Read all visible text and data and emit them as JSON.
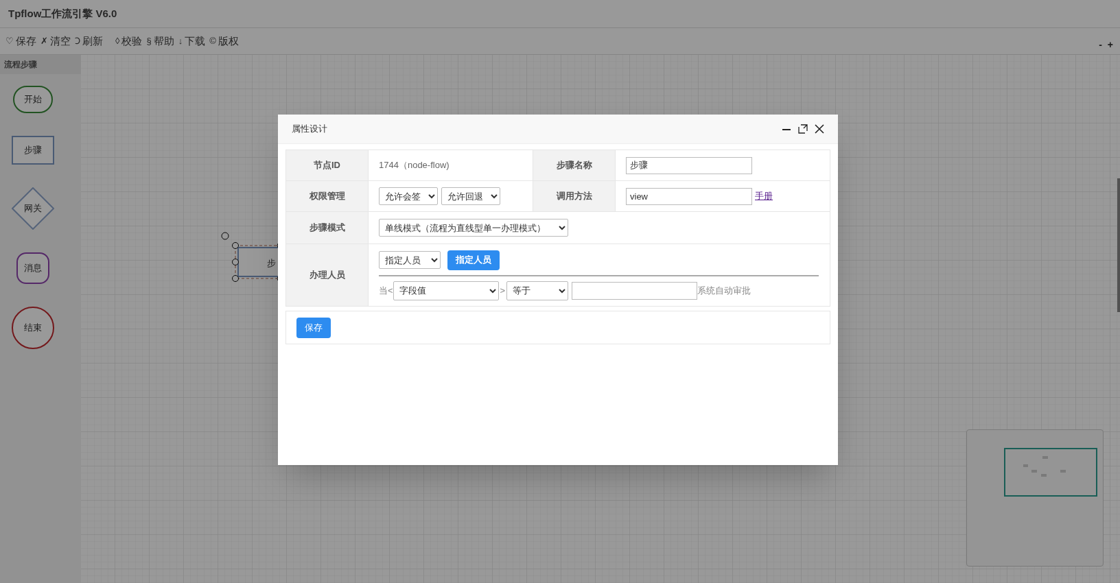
{
  "app": {
    "title": "Tpflow工作流引擎 V6.0"
  },
  "toolbar": [
    {
      "icon": "♡",
      "label": "保存"
    },
    {
      "icon": "✗",
      "label": "清空"
    },
    {
      "icon": "Ↄ",
      "label": "刷新"
    },
    {
      "icon": "◊",
      "label": "校验"
    },
    {
      "icon": "§",
      "label": "帮助"
    },
    {
      "icon": "↓",
      "label": "下载"
    },
    {
      "icon": "©",
      "label": "版权"
    }
  ],
  "zoom_controls": [
    "-",
    "+"
  ],
  "palette": {
    "title": "流程步骤",
    "items": [
      {
        "kind": "start",
        "label": "开始"
      },
      {
        "kind": "step",
        "label": "步骤"
      },
      {
        "kind": "gateway",
        "label": "网关"
      },
      {
        "kind": "message",
        "label": "消息"
      },
      {
        "kind": "end",
        "label": "结束"
      }
    ]
  },
  "canvas": {
    "selected_node": {
      "label": "步"
    }
  },
  "dialog": {
    "title": "属性设计",
    "node_id": {
      "label": "节点ID",
      "value": "1744（node-flow)"
    },
    "step_name": {
      "label": "步骤名称",
      "value": "步骤"
    },
    "permissions": {
      "label": "权限管理",
      "selects": [
        "允许会签",
        "允许回退"
      ]
    },
    "call_method": {
      "label": "调用方法",
      "value": "view",
      "link": "手册"
    },
    "step_mode": {
      "label": "步骤模式",
      "select": "单线模式（流程为直线型单一办理模式）"
    },
    "handler": {
      "label": "办理人员",
      "select": "指定人员",
      "button": "指定人员",
      "condition_prefix": "当<",
      "field_select": "字段值",
      "separator": ">",
      "operator_select": "等于",
      "suffix": "系统自动审批"
    },
    "save_button": "保存"
  }
}
